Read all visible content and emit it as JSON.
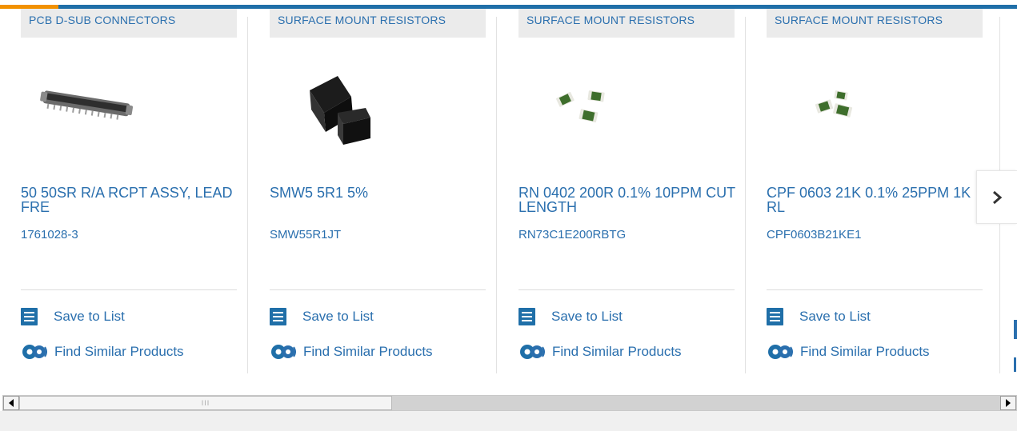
{
  "products": [
    {
      "category": "PCB D-SUB CONNECTORS",
      "title": "50 50SR R/A RCPT ASSY, LEAD FRE",
      "part_number": "1761028-3",
      "image_icon": "connector-image",
      "save_label": "Save to List",
      "find_label": "Find Similar Products"
    },
    {
      "category": "SURFACE MOUNT RESISTORS",
      "title": "SMW5 5R1 5%",
      "part_number": "SMW55R1JT",
      "image_icon": "power-resistor-image",
      "save_label": "Save to List",
      "find_label": "Find Similar Products"
    },
    {
      "category": "SURFACE MOUNT RESISTORS",
      "title": "RN 0402 200R 0.1% 10PPM CUT LENGTH",
      "part_number": "RN73C1E200RBTG",
      "image_icon": "chip-resistor-image",
      "save_label": "Save to List",
      "find_label": "Find Similar Products"
    },
    {
      "category": "SURFACE MOUNT RESISTORS",
      "title": "CPF 0603 21K 0.1% 25PPM 1K RL",
      "part_number": "CPF0603B21KE1",
      "image_icon": "chip-resistor-image",
      "save_label": "Save to List",
      "find_label": "Find Similar Products"
    }
  ],
  "carousel": {
    "next_icon": "chevron-right-icon"
  },
  "scrollbar": {
    "left_icon": "arrow-left-icon",
    "right_icon": "arrow-right-icon",
    "grip": "III",
    "thumb_fraction": 0.38
  },
  "colors": {
    "link": "#2a6fae",
    "accent_bar": "#1f6fa8",
    "accent_tab": "#f29100",
    "category_bg": "#ebebeb"
  }
}
